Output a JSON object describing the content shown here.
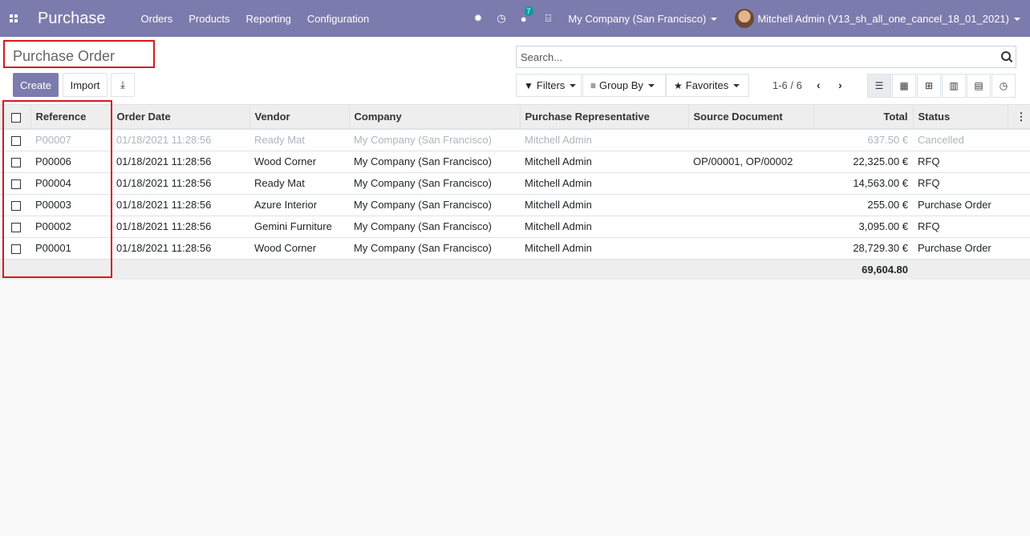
{
  "navbar": {
    "brand": "Purchase",
    "menu": [
      "Orders",
      "Products",
      "Reporting",
      "Configuration"
    ],
    "messages_count": "7",
    "company": "My Company (San Francisco)",
    "user": "Mitchell Admin (V13_sh_all_one_cancel_18_01_2021)"
  },
  "control": {
    "title": "Purchase Order",
    "create_label": "Create",
    "import_label": "Import",
    "search_placeholder": "Search...",
    "filters_label": "Filters",
    "groupby_label": "Group By",
    "favorites_label": "Favorites",
    "pager": "1-6 / 6"
  },
  "table": {
    "columns": [
      "Reference",
      "Order Date",
      "Vendor",
      "Company",
      "Purchase Representative",
      "Source Document",
      "Total",
      "Status"
    ],
    "rows": [
      {
        "ref": "P00007",
        "date": "01/18/2021 11:28:56",
        "vendor": "Ready Mat",
        "company": "My Company (San Francisco)",
        "rep": "Mitchell Admin",
        "source": "",
        "total": "637.50 €",
        "status": "Cancelled"
      },
      {
        "ref": "P00006",
        "date": "01/18/2021 11:28:56",
        "vendor": "Wood Corner",
        "company": "My Company (San Francisco)",
        "rep": "Mitchell Admin",
        "source": "OP/00001, OP/00002",
        "total": "22,325.00 €",
        "status": "RFQ"
      },
      {
        "ref": "P00004",
        "date": "01/18/2021 11:28:56",
        "vendor": "Ready Mat",
        "company": "My Company (San Francisco)",
        "rep": "Mitchell Admin",
        "source": "",
        "total": "14,563.00 €",
        "status": "RFQ"
      },
      {
        "ref": "P00003",
        "date": "01/18/2021 11:28:56",
        "vendor": "Azure Interior",
        "company": "My Company (San Francisco)",
        "rep": "Mitchell Admin",
        "source": "",
        "total": "255.00 €",
        "status": "Purchase Order"
      },
      {
        "ref": "P00002",
        "date": "01/18/2021 11:28:56",
        "vendor": "Gemini Furniture",
        "company": "My Company (San Francisco)",
        "rep": "Mitchell Admin",
        "source": "",
        "total": "3,095.00 €",
        "status": "RFQ"
      },
      {
        "ref": "P00001",
        "date": "01/18/2021 11:28:56",
        "vendor": "Wood Corner",
        "company": "My Company (San Francisco)",
        "rep": "Mitchell Admin",
        "source": "",
        "total": "28,729.30 €",
        "status": "Purchase Order"
      }
    ],
    "footer_total": "69,604.80"
  },
  "colors": {
    "navbar": "#7c7bad",
    "highlight_box": "#d9171e",
    "muted_row": "#adb5bd"
  }
}
